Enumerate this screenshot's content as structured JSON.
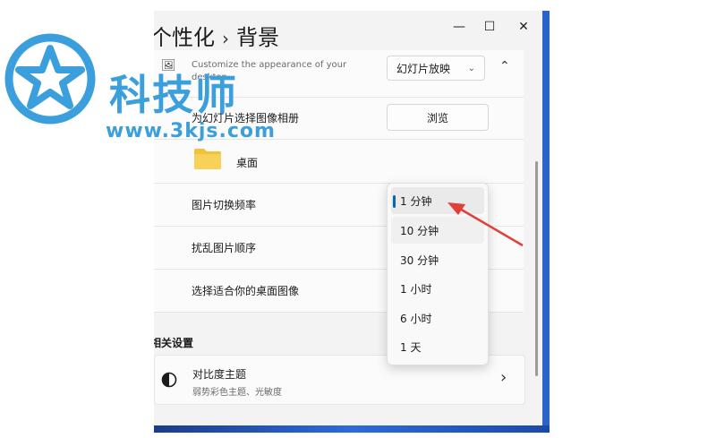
{
  "breadcrumb": {
    "parent": "个性化",
    "separator": "›",
    "current": "背景"
  },
  "window_controls": {
    "minimize": "—",
    "maximize": "☐",
    "close": "✕"
  },
  "personalize": {
    "desc": "Customize the appearance of your desktop",
    "dropdown_value": "幻灯片放映",
    "chevron_up": "⌃"
  },
  "album": {
    "label": "为幻灯片选择图像相册",
    "button": "浏览"
  },
  "folder": {
    "label": "桌面"
  },
  "interval": {
    "label": "图片切换频率"
  },
  "shuffle": {
    "label": "扰乱图片顺序"
  },
  "fit": {
    "label": "选择适合你的桌面图像"
  },
  "related": {
    "title": "相关设置"
  },
  "contrast": {
    "title": "对比度主题",
    "sub": "弱势彩色主题、光敏度",
    "chevron": "›"
  },
  "dropdown_options": [
    "1 分钟",
    "10 分钟",
    "30 分钟",
    "1 小时",
    "6 小时",
    "1 天"
  ],
  "selected_option": "1 分钟",
  "watermark": {
    "brand": "科技师",
    "url": "www.3kjs.com"
  },
  "colors": {
    "accent": "#0067c0",
    "arrow": "#e0403a",
    "watermark": "#3a9fdc"
  }
}
